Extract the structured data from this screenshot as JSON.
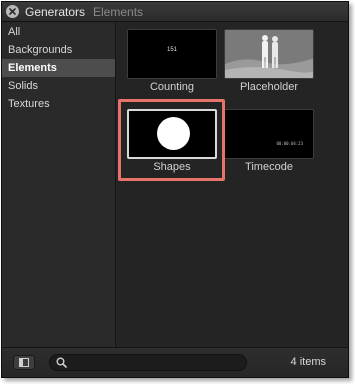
{
  "header": {
    "title": "Generators",
    "subtitle": "Elements",
    "close_icon": "close-icon"
  },
  "sidebar": {
    "items": [
      {
        "label": "All",
        "selected": false
      },
      {
        "label": "Backgrounds",
        "selected": false
      },
      {
        "label": "Elements",
        "selected": true
      },
      {
        "label": "Solids",
        "selected": false
      },
      {
        "label": "Textures",
        "selected": false
      }
    ]
  },
  "browser": {
    "items": [
      {
        "label": "Counting",
        "thumb_text": "151"
      },
      {
        "label": "Placeholder"
      },
      {
        "label": "Shapes",
        "highlighted": true
      },
      {
        "label": "Timecode",
        "thumb_text": "00:00:04:23"
      }
    ],
    "highlight_color": "#e8736b"
  },
  "footer": {
    "search_value": "",
    "item_count": "4 items",
    "toggle_icon": "sidebar-toggle-icon",
    "search_icon": "search-icon"
  }
}
